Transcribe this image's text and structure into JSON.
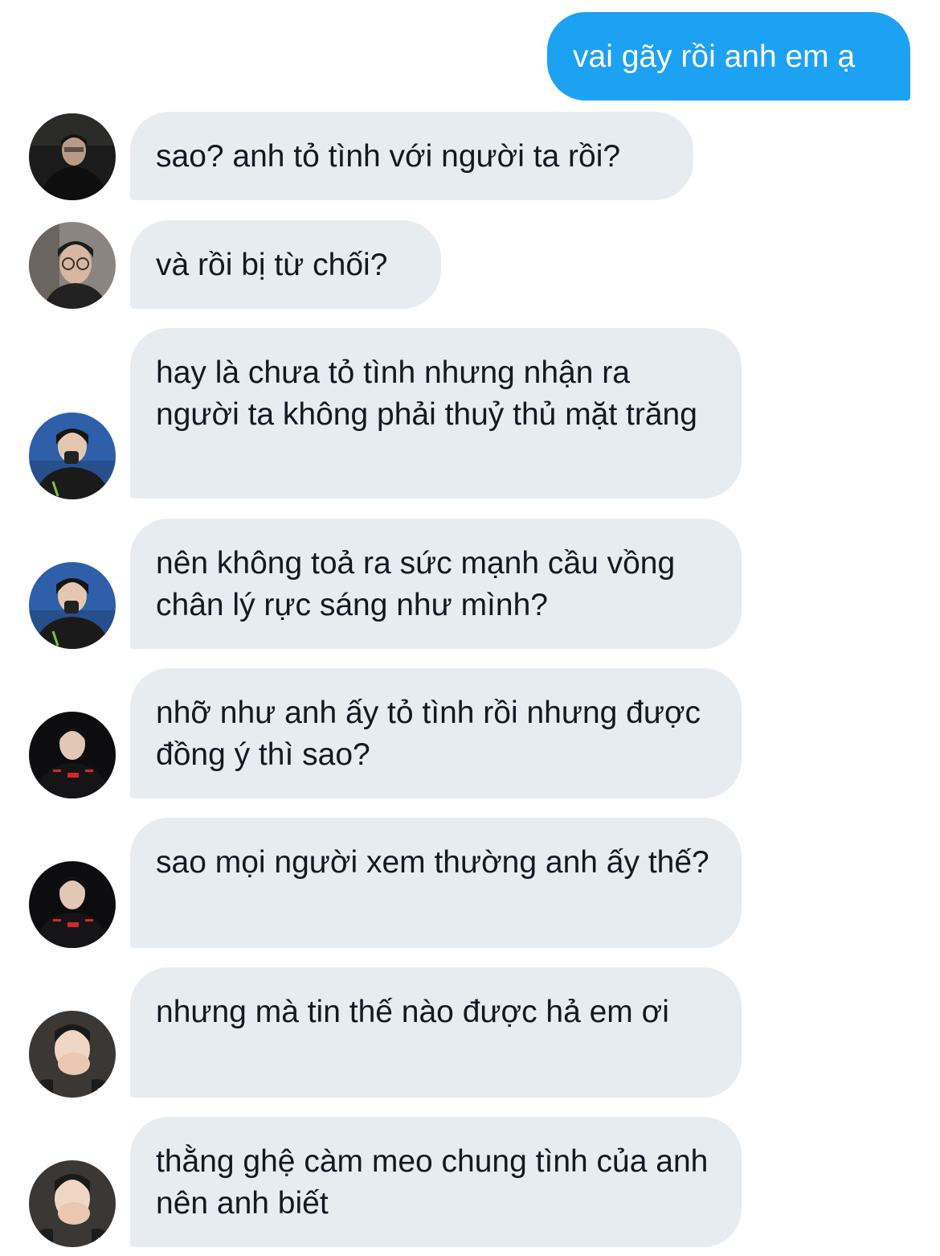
{
  "messages": [
    {
      "side": "sent",
      "text": "vai gãy rồi anh em ạ"
    },
    {
      "side": "received",
      "avatar": "avatar-dark-office",
      "text": "sao? anh tỏ tình với người ta rồi?"
    },
    {
      "side": "received",
      "avatar": "avatar-glasses",
      "text": "và rồi bị từ chối?"
    },
    {
      "side": "received",
      "avatar": "avatar-blue-hand",
      "text": "hay là chưa tỏ tình nhưng nhận ra người ta không phải thuỷ thủ mặt trăng"
    },
    {
      "side": "received",
      "avatar": "avatar-blue-hand",
      "text": "nên không toả ra sức mạnh cầu vồng chân lý rực sáng như mình?"
    },
    {
      "side": "received",
      "avatar": "avatar-dark-jersey",
      "text": "nhỡ như anh ấy tỏ tình rồi nhưng được đồng ý thì sao?"
    },
    {
      "side": "received",
      "avatar": "avatar-dark-jersey",
      "text": "sao mọi người xem thường anh ấy thế?"
    },
    {
      "side": "received",
      "avatar": "avatar-hand-mouth",
      "text": "nhưng mà tin thế nào được hả em ơi"
    },
    {
      "side": "received",
      "avatar": "avatar-hand-mouth",
      "text": "thằng ghệ càm meo chung tình của anh nên anh biết"
    }
  ],
  "colors": {
    "sent_bubble": "#1da1f2",
    "received_bubble": "#e6ecf0",
    "text_dark": "#141823",
    "text_light": "#ffffff"
  }
}
